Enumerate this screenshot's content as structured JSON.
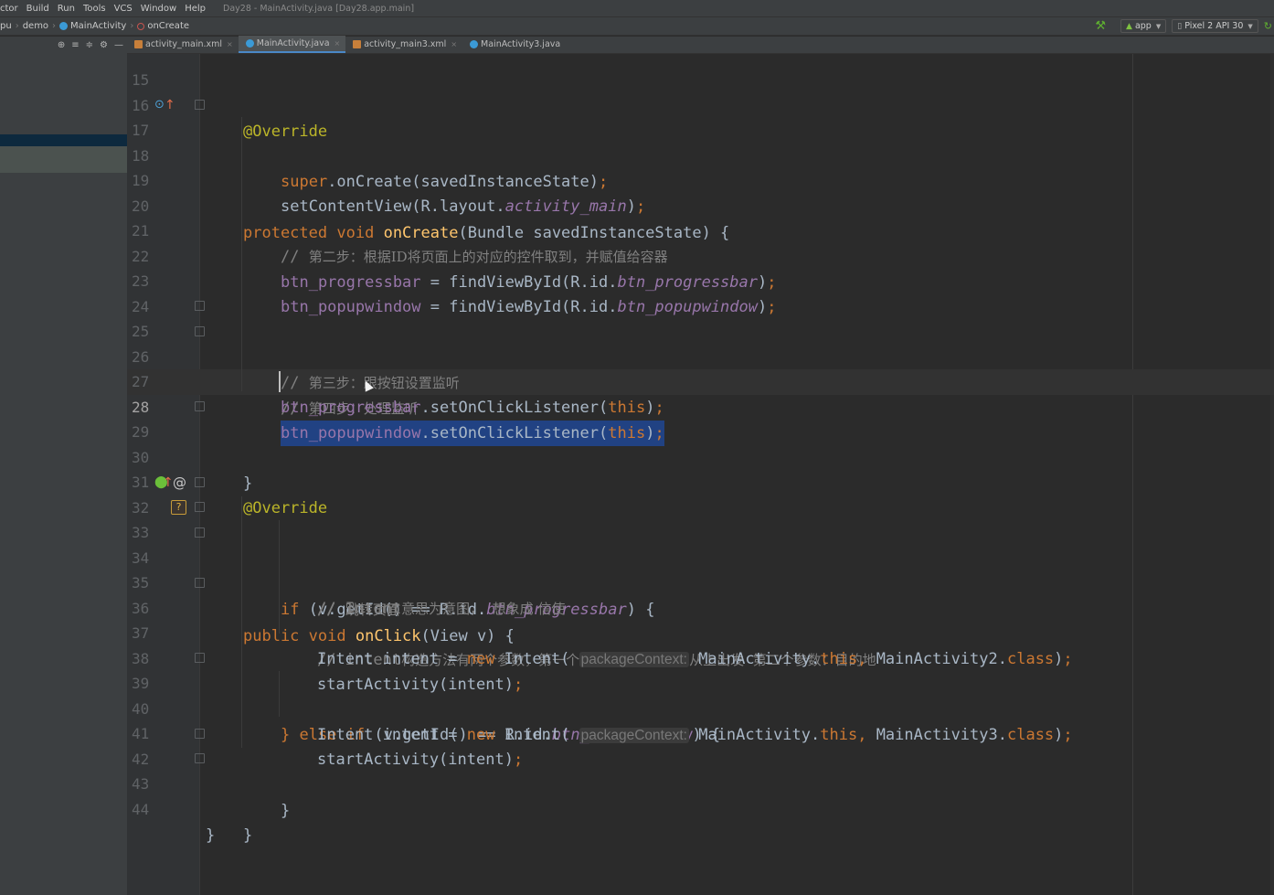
{
  "menu": {
    "items": [
      "ctor",
      "Build",
      "Run",
      "Tools",
      "VCS",
      "Window",
      "Help"
    ],
    "window_title": "Day28 - MainActivity.java [Day28.app.main]"
  },
  "navbar": {
    "crumbs": [
      "pu",
      "demo",
      "MainActivity",
      "onCreate"
    ],
    "run_config": "app",
    "device": "Pixel 2 API 30"
  },
  "tabs": [
    {
      "label": "activity_main.xml",
      "type": "xml"
    },
    {
      "label": "MainActivity.java",
      "type": "java",
      "active": true
    },
    {
      "label": "activity_main3.xml",
      "type": "xml"
    },
    {
      "label": "MainActivity3.java",
      "type": "java"
    }
  ],
  "current_line": "28",
  "lines": {
    "l15": "15",
    "l16": "16",
    "l17": "17",
    "l18": "18",
    "l19": "19",
    "l20": "20",
    "l21": "21",
    "l22": "22",
    "l23": "23",
    "l24": "24",
    "l25": "25",
    "l26": "26",
    "l27": "27",
    "l28": "28",
    "l29": "29",
    "l30": "30",
    "l31": "31",
    "l32": "32",
    "l33": "33",
    "l34": "34",
    "l35": "35",
    "l36": "36",
    "l37": "37",
    "l38": "38",
    "l39": "39",
    "l40": "40",
    "l41": "41",
    "l42": "42",
    "l43": "43",
    "l44": "44"
  },
  "code": {
    "annotation": "@Override",
    "protected": "protected",
    "void": "void",
    "public": "public",
    "onCreate": "onCreate",
    "onCreate_params": "(Bundle savedInstanceState) {",
    "super": "super",
    "super_call": ".onCreate(savedInstanceState)",
    "setContentView_pre": "setContentView(R.layout.",
    "activity_main": "activity_main",
    "paren_close": ")",
    "semi": ";",
    "comment_step2_prefix": "// ",
    "comment_step2": "第二步：根据ID将页面上的对应的控件取到，并赋值给容器",
    "btn_progressbar": "btn_progressbar",
    "btn_popupwindow": "btn_popupwindow",
    "find_pre": " = findViewById(R.id.",
    "comment_step3": "第三步：跟按钮设置监听",
    "comment_step4": "第四步：处理监听",
    "setListener": ".setOnClickListener(",
    "this": "this",
    "close_brace": "}",
    "onClick": "onClick",
    "onClick_params": "(View v) {",
    "if": "if",
    "getId_cond": " (v.getId() == R.id.",
    "cond_close": ") {",
    "comment_jump": "跳转页面",
    "comment_intent_prefix": "// Intent",
    "comment_intent": "意思为意图，  想象成 信使",
    "comment_ctor_prefix": "// intent",
    "comment_ctor": "构造方法有两个参数，第一个参数：上下文表示从上出发  第二个参数：目的地",
    "intent_decl": "Intent intent = ",
    "new": "new",
    "intent_ctor": " Intent(",
    "hint_packageContext": "packageContext:",
    "mainactivity_dot": " MainActivity.",
    "comma": ",",
    "target2": " MainActivity2.",
    "target3": " MainActivity3.",
    "class": "class",
    "startActivity": "startActivity(intent)",
    "else": "} else",
    "else_if": " if"
  }
}
